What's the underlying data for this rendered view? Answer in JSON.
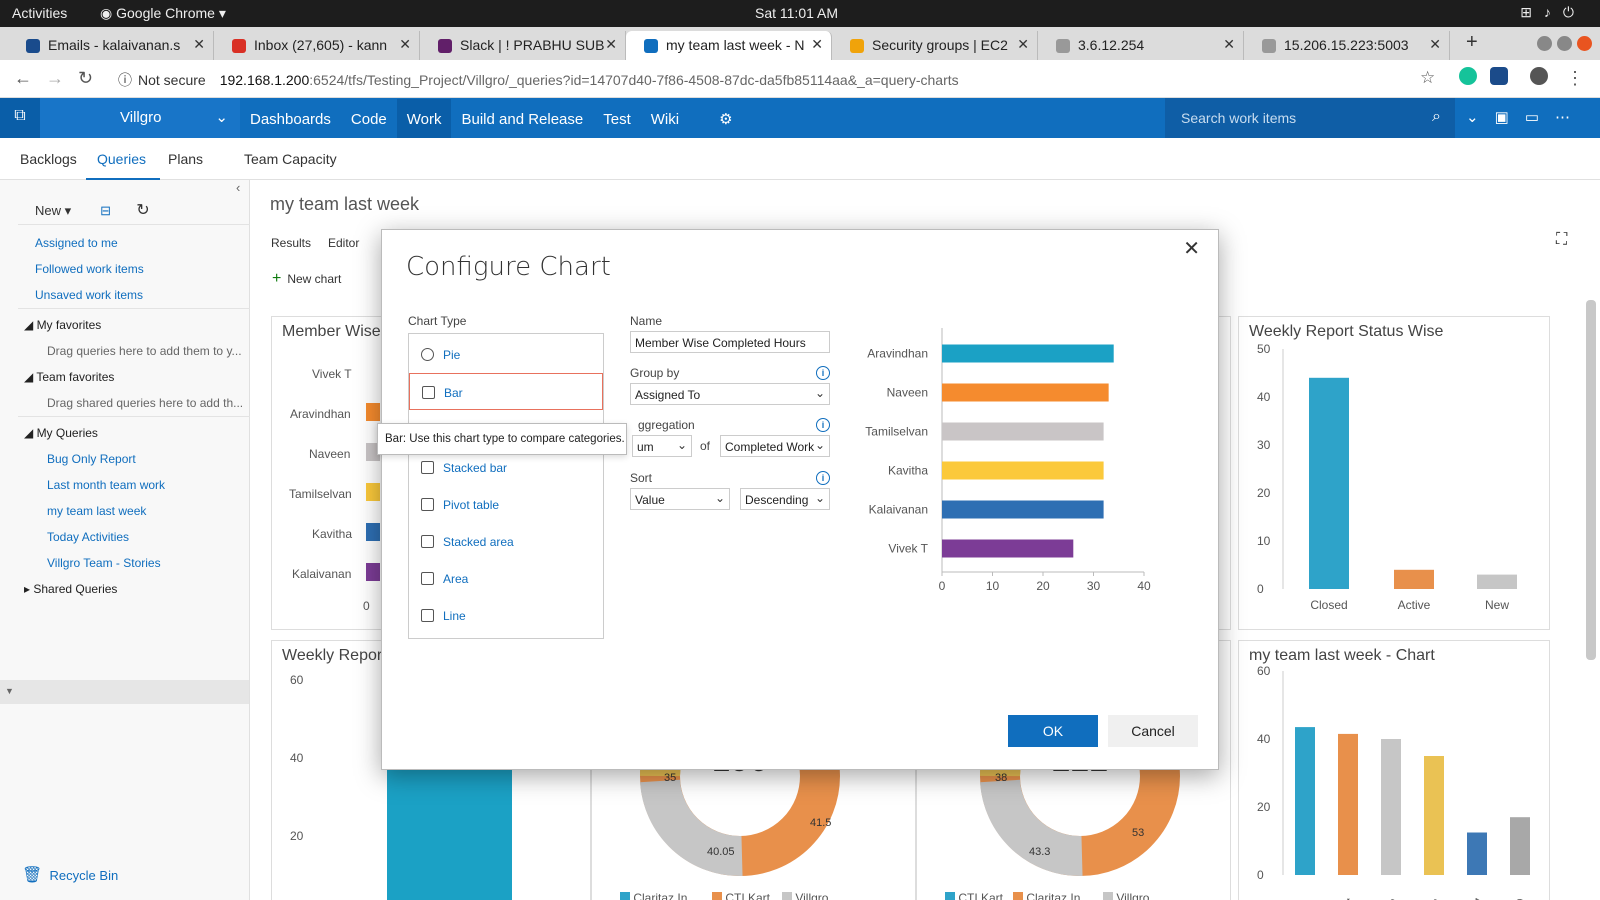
{
  "os": {
    "activities": "Activities",
    "app": "Google Chrome",
    "clock": "Sat 11:01 AM"
  },
  "browser": {
    "tabs": [
      {
        "label": "Emails - kalaivanan.s",
        "color": "#1a4b8c"
      },
      {
        "label": "Inbox (27,605) - kann",
        "color": "#d93025"
      },
      {
        "label": "Slack | ! PRABHU SUB",
        "color": "#611f69"
      },
      {
        "label": "my team last week - N",
        "color": "#106ebe"
      },
      {
        "label": "Security groups | EC2",
        "color": "#f0a30a"
      },
      {
        "label": "3.6.12.254",
        "color": "#999999"
      },
      {
        "label": "15.206.15.223:5003",
        "color": "#999999"
      }
    ],
    "not_secure": "Not secure",
    "url_host": "192.168.1.200",
    "url_path": ":6524/tfs/Testing_Project/Villgro/_queries?id=14707d40-7f86-4508-87dc-da5fb85114aa&_a=query-charts"
  },
  "header": {
    "project": "Villgro",
    "nav": [
      "Dashboards",
      "Code",
      "Work",
      "Build and Release",
      "Test",
      "Wiki"
    ],
    "search_placeholder": "Search work items"
  },
  "subnav": {
    "items": [
      "Backlogs",
      "Queries",
      "Plans",
      "Team Capacity"
    ]
  },
  "sidebar": {
    "new_label": "New",
    "links": [
      "Assigned to me",
      "Followed work items",
      "Unsaved work items"
    ],
    "my_favorites": "My favorites",
    "my_fav_hint": "Drag queries here to add them to y...",
    "team_favorites": "Team favorites",
    "team_fav_hint": "Drag shared queries here to add th...",
    "my_queries": "My Queries",
    "queries": [
      "Bug Only Report",
      "Last month team work",
      "my team last week",
      "Today Activities",
      "Villgro Team - Stories"
    ],
    "shared": "Shared Queries",
    "recycle": "Recycle Bin"
  },
  "main": {
    "title": "my team last week",
    "tabs": [
      "Results",
      "Editor"
    ],
    "new_chart": "New chart"
  },
  "background_tiles": {
    "member_title": "Member Wise",
    "member_names": [
      "Vivek T",
      "Aravindhan",
      "Naveen",
      "Tamilselvan",
      "Kavitha",
      "Kalaivanan"
    ],
    "member_zero": "0",
    "weekly_title": "Weekly Repor",
    "weekly_ticks": [
      "60",
      "40",
      "20"
    ],
    "donut1_total": "190",
    "donut1_labels": [
      "35",
      "41.5",
      "40.05"
    ],
    "donut1_legend": [
      "Claritaz In...",
      "CTI Kart",
      "Villgro"
    ],
    "donut2_total": "222",
    "donut2_labels": [
      "38",
      "53",
      "43.3"
    ],
    "donut2_legend": [
      "CTI Kart",
      "Claritaz In...",
      "Villgro"
    ],
    "status_title": "Weekly Report Status Wise",
    "status_ticks": [
      "50",
      "40",
      "30",
      "20",
      "10",
      "0"
    ],
    "status_categories": [
      "Closed",
      "Active",
      "New"
    ],
    "status_values": [
      44,
      4,
      3
    ],
    "team_title": "my team last week - Chart",
    "team_ticks": [
      "60",
      "40",
      "20",
      "0"
    ],
    "team_values": [
      43.5,
      41.5,
      40,
      35,
      12.5,
      17
    ],
    "team_colors": [
      "#2ea3c9",
      "#e8904b",
      "#c6c6c6",
      "#eac254",
      "#3d78b5",
      "#a8a8a8"
    ],
    "team_xlabels": [
      "In...",
      "Kart",
      "lgro",
      "aan",
      "eM",
      "her)"
    ]
  },
  "dialog": {
    "title": "Configure Chart",
    "chart_type_label": "Chart Type",
    "chart_types": [
      "Pie",
      "Bar",
      "Stacked bar",
      "Pivot table",
      "Stacked area",
      "Area",
      "Line"
    ],
    "selected_type": "Bar",
    "tooltip": "Bar: Use this chart type to compare categories.",
    "name_label": "Name",
    "name_value": "Member Wise Completed Hours",
    "group_by_label": "Group by",
    "group_by_value": "Assigned To",
    "aggregation_label": "ggregation",
    "aggregation_func": "um",
    "of_label": "of",
    "aggregation_field": "Completed Work",
    "sort_label": "Sort",
    "sort_by": "Value",
    "sort_dir": "Descending",
    "ok": "OK",
    "cancel": "Cancel"
  },
  "chart_data": {
    "type": "bar",
    "orientation": "horizontal",
    "categories": [
      "Aravindhan",
      "Naveen",
      "Tamilselvan",
      "Kavitha",
      "Kalaivanan",
      "Vivek T"
    ],
    "values": [
      34,
      33,
      32,
      32,
      32,
      26
    ],
    "colors": [
      "#1ba1c5",
      "#f58b2e",
      "#c9c5c6",
      "#fbc93b",
      "#2e6fb3",
      "#7c3c96"
    ],
    "xlim": [
      0,
      40
    ],
    "x_ticks": [
      "0",
      "10",
      "20",
      "30",
      "40"
    ],
    "grid": false
  }
}
